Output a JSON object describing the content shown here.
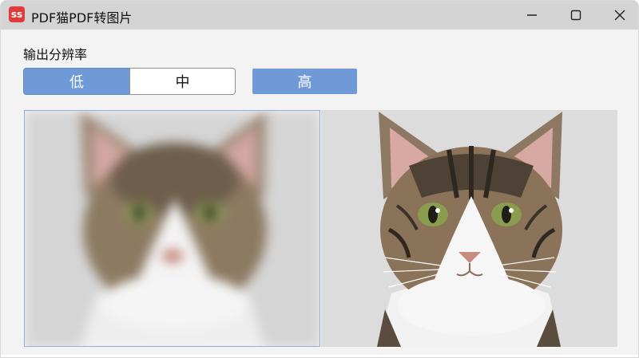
{
  "window": {
    "title": "PDF猫PDF转图片",
    "app_icon_text": "ss"
  },
  "resolution": {
    "label": "输出分辨率",
    "options": [
      {
        "label": "低",
        "selected": true
      },
      {
        "label": "中",
        "selected": false
      },
      {
        "label": "高",
        "selected": false
      }
    ]
  },
  "preview": {
    "left_image": "low-resolution-cat-preview",
    "right_image": "high-resolution-cat-preview"
  },
  "colors": {
    "accent": "#6f9ad7",
    "titlebar": "#d4d4d4",
    "background": "#f3f3f3"
  }
}
